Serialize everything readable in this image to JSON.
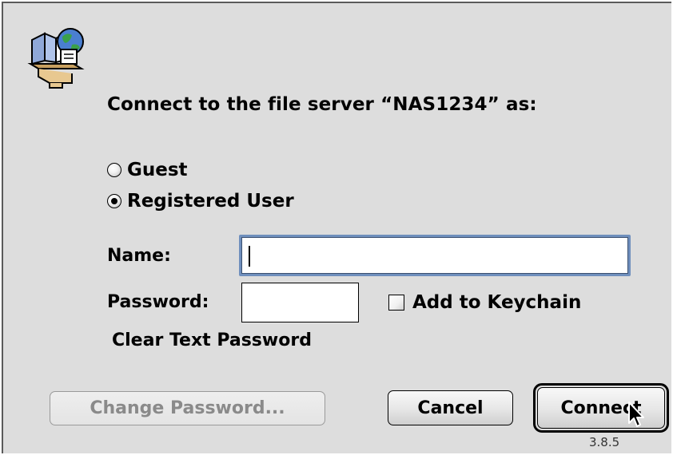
{
  "dialog": {
    "prompt": "Connect to the file server “NAS1234” as:",
    "icon": "file-server-icon"
  },
  "login_type": {
    "options": [
      {
        "label": "Guest",
        "selected": false
      },
      {
        "label": "Registered User",
        "selected": true
      }
    ]
  },
  "fields": {
    "name_label": "Name:",
    "name_value": "",
    "password_label": "Password:",
    "password_value": "",
    "keychain_label": "Add to Keychain",
    "keychain_checked": false
  },
  "security": {
    "note": "Clear Text Password"
  },
  "buttons": {
    "change_password": "Change Password...",
    "cancel": "Cancel",
    "connect": "Connect"
  },
  "version": "3.8.5",
  "colors": {
    "dialog_bg": "#dddddd",
    "focus_ring": "#6f8fbd",
    "disabled_text": "#8a8a8a"
  }
}
